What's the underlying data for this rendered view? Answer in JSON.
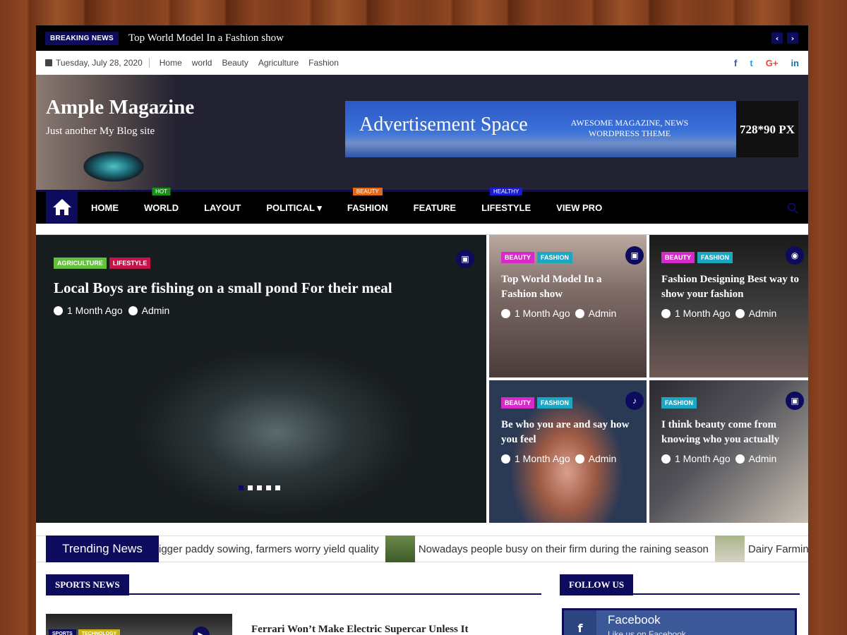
{
  "breaking": {
    "label": "BREAKING NEWS",
    "headline": "Top World Model In a Fashion show",
    "prev": "‹",
    "next": "›"
  },
  "topbar": {
    "date": "Tuesday, July 28, 2020",
    "links": [
      "Home",
      "world",
      "Beauty",
      "Agriculture",
      "Fashion"
    ],
    "social": [
      "f",
      "t",
      "G+",
      "in"
    ]
  },
  "header": {
    "title": "Ample Magazine",
    "tagline": "Just another My Blog site"
  },
  "ad": {
    "title": "Advertisement Space",
    "subtitle": "AWESOME MAGAZINE, NEWS WORDPRESS THEME",
    "size": "728*90 PX"
  },
  "nav": {
    "items": [
      {
        "label": "HOME",
        "tag": "",
        "tag_color": ""
      },
      {
        "label": "WORLD",
        "tag": "HOT",
        "tag_color": "#1a8f1a"
      },
      {
        "label": "LAYOUT",
        "tag": "",
        "tag_color": ""
      },
      {
        "label": "POLITICAL ▾",
        "tag": "",
        "tag_color": ""
      },
      {
        "label": "FASHION",
        "tag": "BEAUTY",
        "tag_color": "#e0691a"
      },
      {
        "label": "FEATURE",
        "tag": "",
        "tag_color": ""
      },
      {
        "label": "LIFESTYLE",
        "tag": "HEALTHY",
        "tag_color": "#1b1bd6"
      },
      {
        "label": "VIEW PRO",
        "tag": "",
        "tag_color": ""
      }
    ]
  },
  "featured": {
    "main": {
      "cats": [
        "AGRICULTURE",
        "LIFESTYLE"
      ],
      "title": "Local Boys are fishing on a small pond For their meal",
      "time": "1 Month Ago",
      "author": "Admin"
    },
    "cards": [
      {
        "cats": [
          "BEAUTY",
          "FASHION"
        ],
        "title": "Top World Model In a Fashion show",
        "time": "1 Month Ago",
        "author": "Admin"
      },
      {
        "cats": [
          "BEAUTY",
          "FASHION"
        ],
        "title": "Fashion Designing Best way to show your fashion",
        "time": "1 Month Ago",
        "author": "Admin"
      },
      {
        "cats": [
          "BEAUTY",
          "FASHION"
        ],
        "title": "Be who you are and say how you feel",
        "time": "1 Month Ago",
        "author": "Admin"
      },
      {
        "cats": [
          "FASHION"
        ],
        "title": "I think beauty come from knowing who you actually",
        "time": "1 Month Ago",
        "author": "Admin"
      }
    ]
  },
  "trending": {
    "label": "Trending News",
    "items": [
      "igger paddy sowing, farmers worry yield quality",
      "Nowadays people busy on their firm during the raining season",
      "Dairy Farmin"
    ]
  },
  "sports": {
    "label": "SPORTS NEWS",
    "title": "Ferrari Won’t Make Electric Supercar Unless It",
    "cats": [
      "SPORTS",
      "TECHNOLOGY"
    ]
  },
  "follow": {
    "label": "FOLLOW US",
    "fb_name": "Facebook",
    "fb_sub": "Like us on Facebook"
  },
  "colors": {
    "primary": "#0c0b5e",
    "beauty": "#d62bc8",
    "fashion": "#1ba6c2",
    "agriculture": "#62c03c",
    "lifestyle": "#c41447"
  }
}
